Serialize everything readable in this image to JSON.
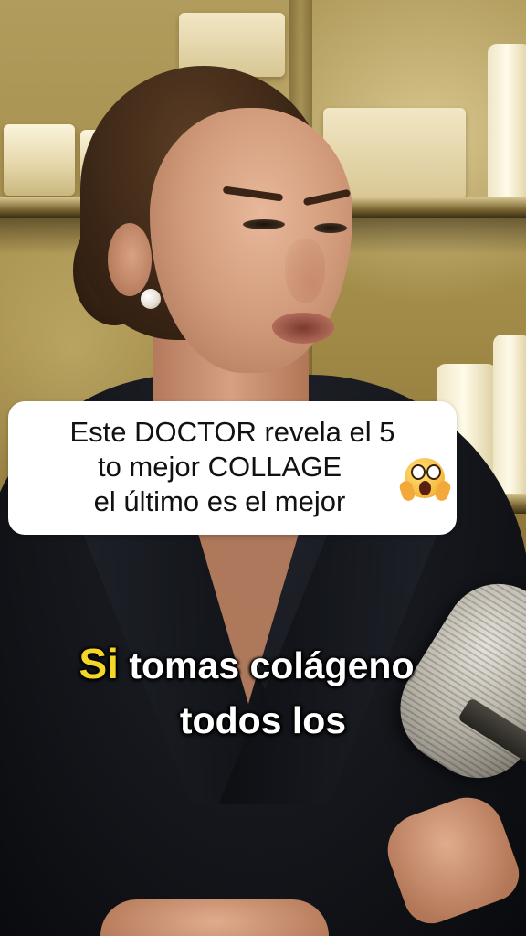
{
  "caption": {
    "line1": "Este DOCTOR revela el 5",
    "line2": "to mejor COLLAGE",
    "line3": "el último es el mejor",
    "emoji": "flushed-face-icon"
  },
  "subtitle": {
    "highlight_word": "Si",
    "line1_rest": " tomas colágeno",
    "line2": "todos los",
    "highlight_color": "#f5d628"
  }
}
